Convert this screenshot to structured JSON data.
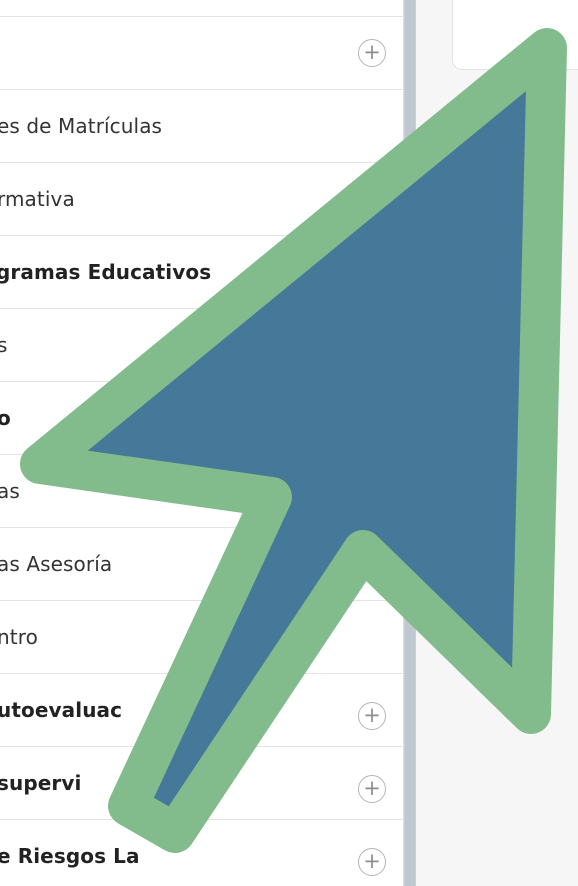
{
  "menu": {
    "items": [
      {
        "label": "",
        "bold": false,
        "faint": true,
        "expandable": true,
        "expand_symbol": "+"
      },
      {
        "label": "es de Matrículas",
        "bold": false,
        "expandable": false
      },
      {
        "label": "rmativa",
        "bold": false,
        "expandable": false
      },
      {
        "label": "gramas Educativos",
        "bold": true,
        "expandable": false
      },
      {
        "label": "s",
        "bold": false,
        "expandable": false
      },
      {
        "label": "o",
        "bold": true,
        "expandable": false
      },
      {
        "label": "as",
        "bold": false,
        "expandable": false
      },
      {
        "label": "as Asesoría",
        "bold": false,
        "expandable": false
      },
      {
        "label": "ntro",
        "bold": false,
        "expandable": false
      },
      {
        "label": "utoevaluac",
        "bold": true,
        "expandable": true,
        "expand_symbol": "+"
      },
      {
        "label": "supervi",
        "bold": true,
        "expandable": true,
        "expand_symbol": "+"
      },
      {
        "label": "e Riesgos La",
        "bold": true,
        "expandable": true,
        "expand_symbol": "+"
      }
    ]
  },
  "cursor": {
    "icon": "arrow-pointer-icon",
    "fill_color": "#467899",
    "outline_color": "#82bb8c"
  },
  "colors": {
    "panel_background": "#ffffff",
    "page_background": "#f6f6f7",
    "divider": "#e3e3e3",
    "scrollbar": "#c9d0d7"
  }
}
